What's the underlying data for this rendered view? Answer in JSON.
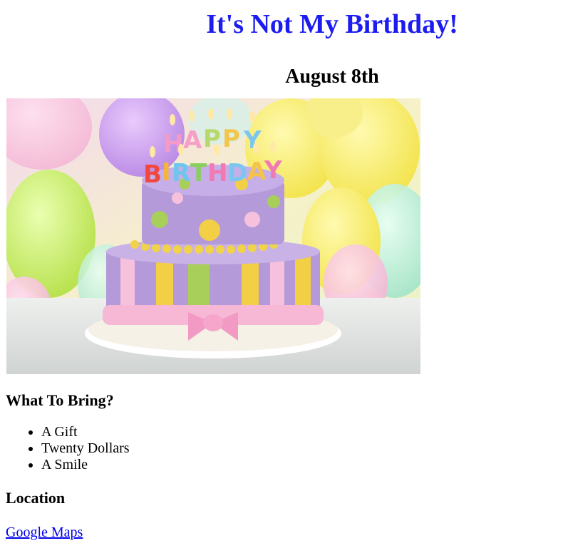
{
  "title": "It's Not My Birthday!",
  "date": "August 8th",
  "image": {
    "alt": "Birthday cake",
    "candle_letters": [
      "H",
      "A",
      "P",
      "P",
      "Y",
      "B",
      "I",
      "R",
      "T",
      "H",
      "D",
      "A",
      "Y"
    ]
  },
  "bring": {
    "heading": "What To Bring?",
    "items": [
      "A Gift",
      "Twenty Dollars",
      "A Smile"
    ]
  },
  "location": {
    "heading": "Location",
    "link_label": "Google Maps"
  },
  "colors": {
    "title": "#1c1cf0",
    "link": "#0000ee"
  }
}
